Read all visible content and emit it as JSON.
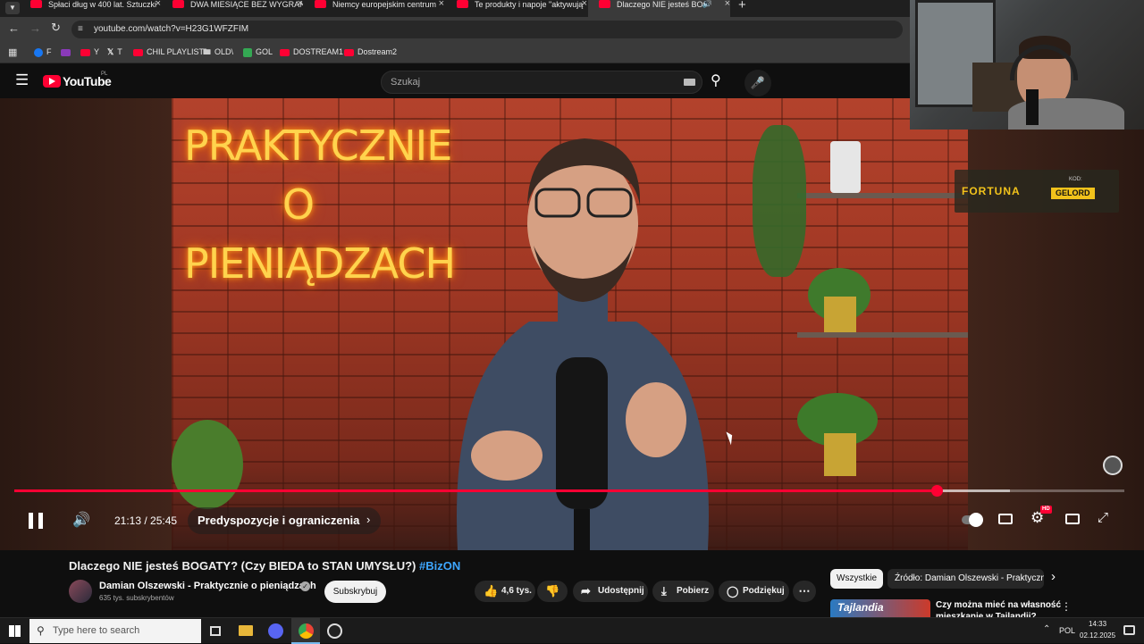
{
  "browser": {
    "tabs": [
      {
        "label": "Spłaci dług w 400 lat. Sztuczki"
      },
      {
        "label": "DWA MIESIĄCE BEZ WYGRANE"
      },
      {
        "label": "Niemcy europejskim centrum"
      },
      {
        "label": "Te produkty i napoje \"aktywują"
      },
      {
        "label": "Dlaczego NIE jesteś BOGAT"
      }
    ],
    "new_tab": "+",
    "url": "youtube.com/watch?v=H23G1WFZFIM",
    "bookmarks": [
      {
        "label": "F",
        "color": "#1877f2"
      },
      {
        "label": "",
        "color": "#8a3ab9"
      },
      {
        "label": "Y",
        "color": "#ff0033"
      },
      {
        "label": "T",
        "color": "#ffffff"
      },
      {
        "label": "CHIL PLAYLIST",
        "color": "#ff0033"
      },
      {
        "label": "OLD\\",
        "color": "#cccccc"
      },
      {
        "label": "GOL",
        "color": "#34a853"
      },
      {
        "label": "DOSTREAM1",
        "color": "#ff0033"
      },
      {
        "label": "Dostream2",
        "color": "#ff0033"
      }
    ]
  },
  "youtube": {
    "logo": "YouTube",
    "logo_region": "PL",
    "search_placeholder": "Szukaj"
  },
  "video": {
    "neon_line1": "PRAKTYCZNIE O",
    "neon_line2": "PIENIĄDZACH",
    "sponsor": "FORTUNA",
    "sponsor_tag": "KOD:",
    "sponsor_code": "GELORD",
    "progress_fraction": 0.8309,
    "buffer_fraction": 0.066
  },
  "controls": {
    "time": "21:13 / 25:45",
    "chapter": "Predyspozycje i ograniczenia",
    "hd_badge": "HD"
  },
  "details": {
    "title": "Dlaczego NIE jesteś BOGATY? (Czy BIEDA to STAN UMYSŁU?)",
    "hashtag": "#BizON",
    "channel": "Damian Olszewski - Praktycznie o pieniądzach",
    "subscribers": "635 tys. subskrybentów",
    "subscribe": "Subskrybuj",
    "likes": "4,6 tys.",
    "share": "Udostępnij",
    "download": "Pobierz",
    "thanks": "Podziękuj",
    "chip_all": "Wszystkie",
    "chip_source": "Źródło: Damian Olszewski - Praktyczn",
    "rec_title_1": "Czy można mieć na własność",
    "rec_title_2": "mieszkanie w Tajlandii?",
    "rec_thumb_text": "Tajlandia"
  },
  "taskbar": {
    "search_placeholder": "Type here to search",
    "lang": "POL",
    "time": "14:33",
    "date": "02.12.2025"
  }
}
